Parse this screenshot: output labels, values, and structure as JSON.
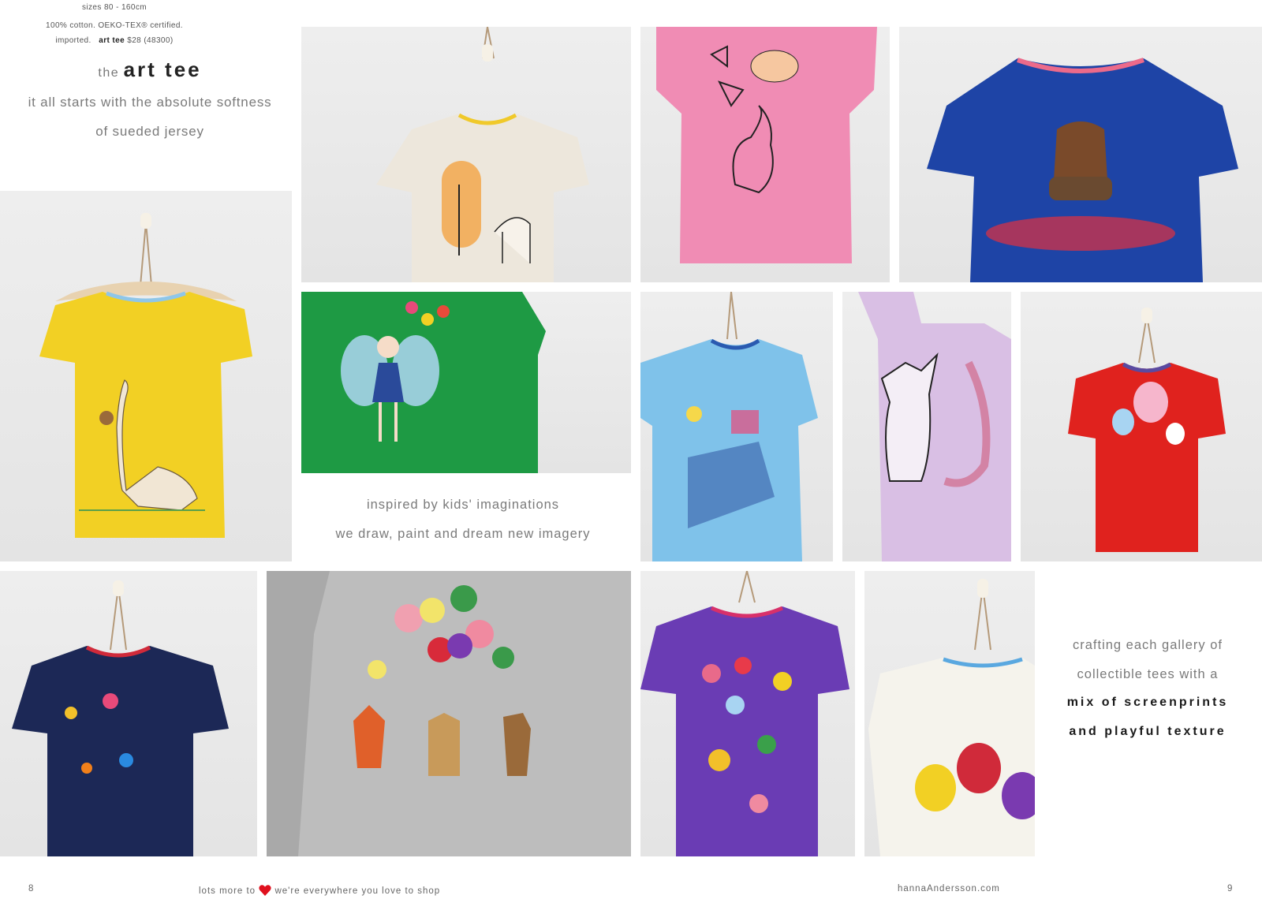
{
  "intro": {
    "title_small": "the",
    "title_big": "art tee",
    "line1": "it all starts with the absolute softness",
    "line2": "of sueded jersey"
  },
  "inspire": {
    "line1": "inspired by kids' imaginations",
    "line2": "we draw, paint and dream new imagery"
  },
  "craft": {
    "line1": "crafting each gallery of",
    "line2": "collectible tees with a",
    "line3": "mix of screenprints",
    "line4": "and playful texture"
  },
  "details": {
    "sizes": "sizes 80 - 160cm",
    "fabric": "100% cotton. OEKO-TEX® certified.",
    "imported": "imported.",
    "product_name": "art tee",
    "price": "$28 (48300)"
  },
  "footer": {
    "page_left": "8",
    "promo_left": "lots more to",
    "promo_right": "we're everywhere you love to shop",
    "website": "hannaAndersson.com",
    "page_right": "9"
  },
  "colors": {
    "heart": "#e0101e",
    "tee_yellow": "#f2d024",
    "tee_oatmeal": "#ede7dc",
    "tee_pink": "#f08cb4",
    "tee_blue": "#1e44a6",
    "tee_green": "#1e9a44",
    "tee_lightblue": "#7fc2ea",
    "tee_lavender": "#d9bfe4",
    "tee_red": "#e0221e",
    "tee_navy": "#1c2856",
    "tee_gray": "#bdbdbd",
    "tee_purple": "#6a3cb4",
    "tee_white": "#f5f3ec"
  },
  "photos": [
    {
      "name": "photo-yellow-dinosaur-tee",
      "print": "dinosaur-print"
    },
    {
      "name": "photo-oatmeal-deer-tee",
      "print": "deer-print"
    },
    {
      "name": "photo-pink-bunny-tee",
      "print": "bunny-butterfly-print"
    },
    {
      "name": "photo-blue-bear-tee",
      "print": "bear-flowers-print"
    },
    {
      "name": "photo-green-fairy-tee",
      "print": "fairy-print"
    },
    {
      "name": "photo-lightblue-map-tee",
      "print": "map-print"
    },
    {
      "name": "photo-lavender-fox-tee",
      "print": "fox-print"
    },
    {
      "name": "photo-red-balloon-tee",
      "print": "balloon-print"
    },
    {
      "name": "photo-navy-flowers-tee",
      "print": "flowers-print"
    },
    {
      "name": "photo-gray-balloons-tee",
      "print": "animals-balloons-print"
    },
    {
      "name": "photo-purple-birds-tee",
      "print": "birds-fruit-print"
    },
    {
      "name": "photo-white-beetles-tee",
      "print": "beetles-print"
    }
  ]
}
